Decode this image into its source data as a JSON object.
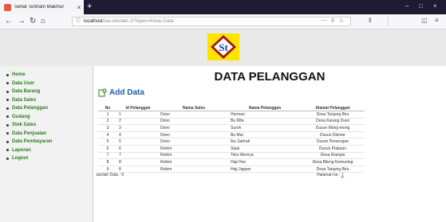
{
  "browser": {
    "tab_title": "Sehat Tentram Makmur",
    "tab_close": "×",
    "new_tab": "+",
    "url_host": "localhost",
    "url_path": "/sia-sekolah-2/?open=Kelas-Data",
    "window_minimize": "–",
    "window_maximize": "□",
    "window_close": "×"
  },
  "logo": {
    "text": "St",
    "color": "#ffe400"
  },
  "sidebar": {
    "items": [
      {
        "label": "Home"
      },
      {
        "label": "Data User"
      },
      {
        "label": "Data Barang"
      },
      {
        "label": "Data Sales"
      },
      {
        "label": "Data Pelanggan"
      },
      {
        "label": "Gudang"
      },
      {
        "label": "Stok Sales"
      },
      {
        "label": "Data Penjualan"
      },
      {
        "label": "Data Pembayaran"
      },
      {
        "label": "Laporan"
      },
      {
        "label": "Logout"
      }
    ]
  },
  "main": {
    "title": "DATA PELANGGAN",
    "add_label": "Add Data",
    "table": {
      "headers": [
        "No",
        "Id Pelanggan",
        "Nama Sales",
        "Nama Pelanggan",
        "Alamat Pelanggan"
      ],
      "rows": [
        [
          "1",
          "1",
          "Dono",
          "Herman",
          "Desa Tanjung Biru"
        ],
        [
          "2",
          "2",
          "Dono",
          "Bu Rifa",
          "Desa Karang Duwi"
        ],
        [
          "3",
          "3",
          "Dono",
          "Suroh",
          "Dusun Mong-mong"
        ],
        [
          "4",
          "4",
          "Dono",
          "Bu Mut",
          "Dusun Dlemer"
        ],
        [
          "5",
          "5",
          "Dono",
          "Ibu Sahrah",
          "Dusun Pereengan"
        ],
        [
          "6",
          "6",
          "Rohim",
          "Sipai",
          "Dusun Plalaran"
        ],
        [
          "7",
          "7",
          "Rohim",
          "Toko Mereya",
          "Desa Klampis"
        ],
        [
          "8",
          "8",
          "Rohim",
          "Haji Hos",
          "Desa Bileng Kemuning"
        ],
        [
          "9",
          "8",
          "Rohim",
          "Haji Jappar",
          "Desa Tanjung Biru"
        ]
      ]
    },
    "footer_count": "Jumlah Data : 9",
    "footer_page_label": "Halaman ke :",
    "footer_page": "1"
  }
}
